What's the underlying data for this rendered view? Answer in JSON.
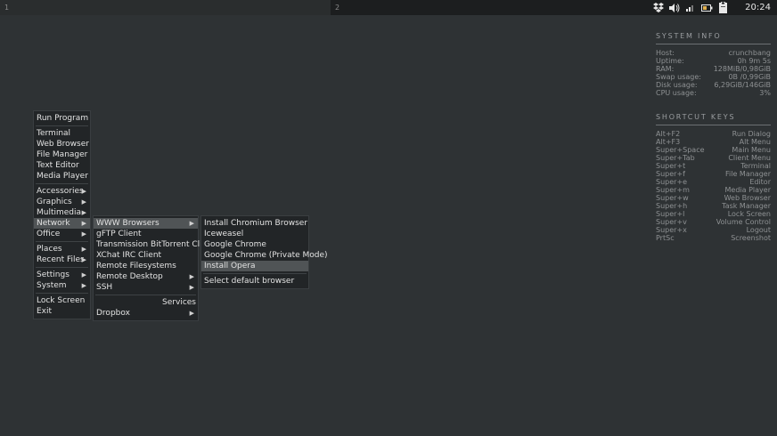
{
  "panel": {
    "workspaces": [
      {
        "label": "1"
      },
      {
        "label": "2"
      }
    ],
    "tray": {
      "icons": [
        "dropbox-icon",
        "volume-icon",
        "network-signal-icon",
        "battery-icon",
        "clipboard-icon"
      ]
    },
    "clock": "20:24"
  },
  "conky": {
    "system_info_title": "SYSTEM INFO",
    "system_info": [
      {
        "k": "Host:",
        "v": "crunchbang"
      },
      {
        "k": "Uptime:",
        "v": "0h 9m 5s"
      },
      {
        "k": "RAM:",
        "v": "128MiB/0,98GiB"
      },
      {
        "k": "Swap usage:",
        "v": "0B /0,99GiB"
      },
      {
        "k": "Disk usage:",
        "v": "6,29GiB/146GiB"
      },
      {
        "k": "CPU usage:",
        "v": "3%"
      }
    ],
    "shortcut_title": "SHORTCUT KEYS",
    "shortcuts": [
      {
        "k": "Alt+F2",
        "v": "Run Dialog"
      },
      {
        "k": "Alt+F3",
        "v": "Alt Menu"
      },
      {
        "k": "Super+Space",
        "v": "Main Menu"
      },
      {
        "k": "Super+Tab",
        "v": "Client Menu"
      },
      {
        "k": "Super+t",
        "v": "Terminal"
      },
      {
        "k": "Super+f",
        "v": "File Manager"
      },
      {
        "k": "Super+e",
        "v": "Editor"
      },
      {
        "k": "Super+m",
        "v": "Media Player"
      },
      {
        "k": "Super+w",
        "v": "Web Browser"
      },
      {
        "k": "Super+h",
        "v": "Task Manager"
      },
      {
        "k": "Super+l",
        "v": "Lock Screen"
      },
      {
        "k": "Super+v",
        "v": "Volume Control"
      },
      {
        "k": "Super+x",
        "v": "Logout"
      },
      {
        "k": "PrtSc",
        "v": "Screenshot"
      }
    ]
  },
  "main_menu": {
    "run_program": "Run Program",
    "terminal": "Terminal",
    "web_browser": "Web Browser",
    "file_manager": "File Manager",
    "text_editor": "Text Editor",
    "media_player": "Media Player",
    "accessories": "Accessories",
    "graphics": "Graphics",
    "multimedia": "Multimedia",
    "network": "Network",
    "office": "Office",
    "places": "Places",
    "recent_files": "Recent Files",
    "settings": "Settings",
    "system": "System",
    "lock_screen": "Lock Screen",
    "exit": "Exit"
  },
  "network_menu": {
    "www_browsers": "WWW Browsers",
    "gftp": "gFTP Client",
    "transmission": "Transmission BitTorrent Client",
    "xchat": "XChat IRC Client",
    "remote_filesystems": "Remote Filesystems",
    "remote_desktop": "Remote Desktop",
    "ssh": "SSH",
    "services": "Services",
    "dropbox": "Dropbox"
  },
  "browsers_menu": {
    "install_chromium": "Install Chromium Browser",
    "iceweasel": "Iceweasel",
    "google_chrome": "Google Chrome",
    "google_chrome_private": "Google Chrome (Private Mode)",
    "install_opera": "Install Opera",
    "select_default": "Select default browser"
  },
  "colors": {
    "desktop": "#2e3234",
    "panel": "#1c1e1f",
    "menu": "#222527",
    "highlight": "#505456",
    "battery": "#e0b050"
  }
}
